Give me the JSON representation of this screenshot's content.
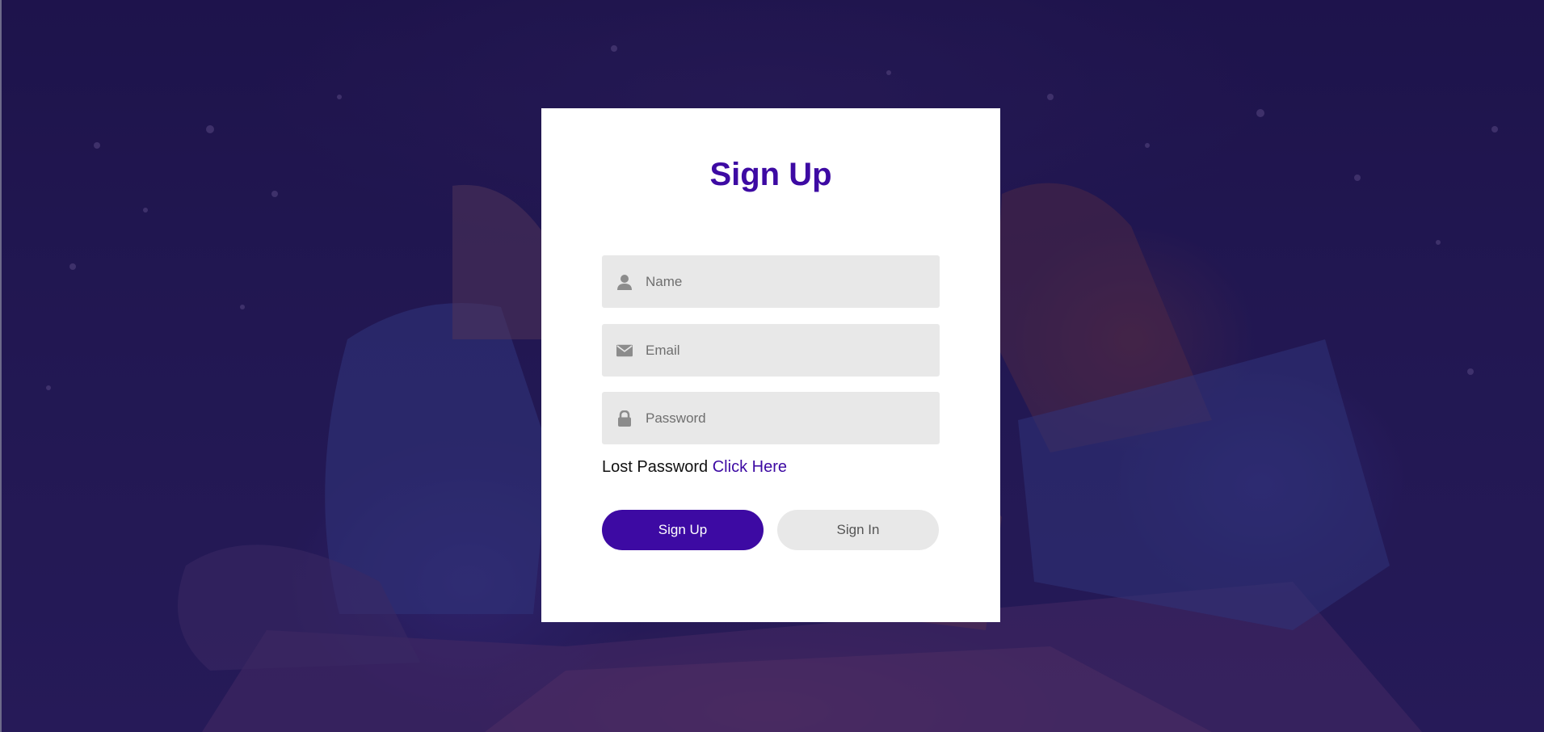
{
  "form": {
    "title": "Sign Up",
    "fields": [
      {
        "icon": "user-icon",
        "placeholder": "Name",
        "value": ""
      },
      {
        "icon": "envelope-icon",
        "placeholder": "Email",
        "value": ""
      },
      {
        "icon": "lock-icon",
        "placeholder": "Password",
        "value": ""
      }
    ],
    "lost_password_text": "Lost Password",
    "lost_password_link": "Click Here",
    "primary_button": "Sign Up",
    "secondary_button": "Sign In"
  },
  "colors": {
    "accent": "#3d0aa3",
    "field_bg": "#e8e8e8",
    "overlay": "#1e0a5a"
  }
}
